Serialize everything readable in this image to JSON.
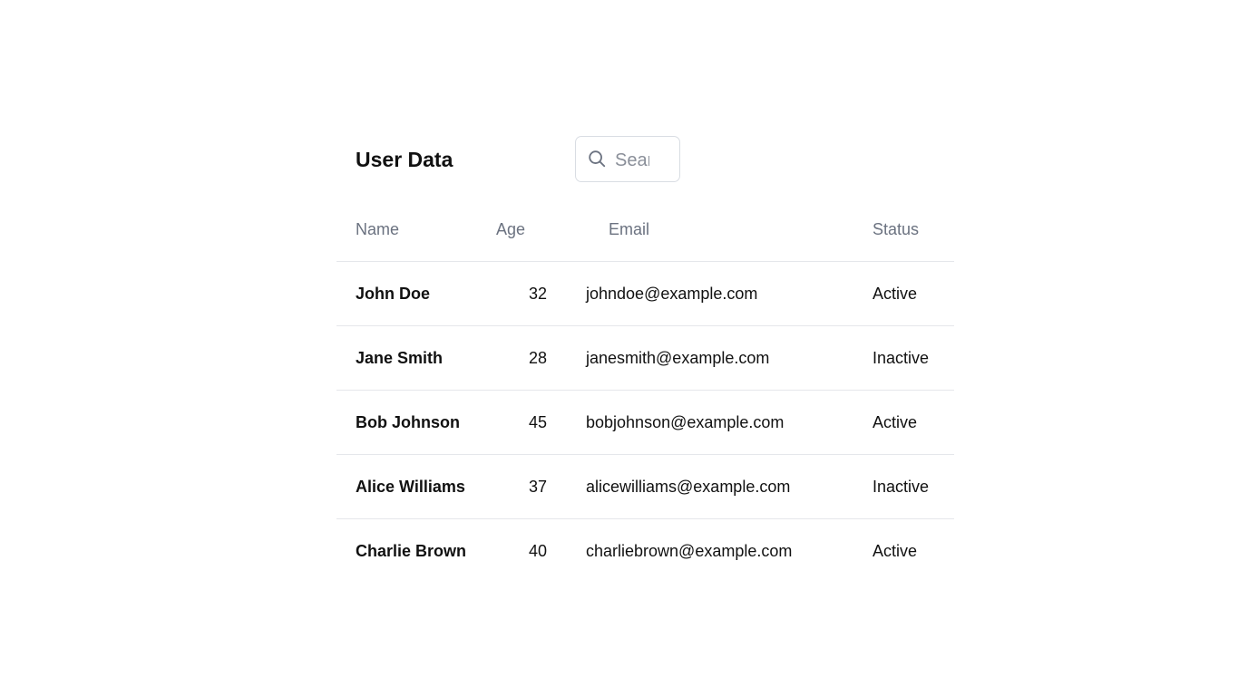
{
  "title": "User Data",
  "search": {
    "placeholder": "Search",
    "value": ""
  },
  "table": {
    "headers": {
      "name": "Name",
      "age": "Age",
      "email": "Email",
      "status": "Status"
    },
    "rows": [
      {
        "name": "John Doe",
        "age": "32",
        "email": "johndoe@example.com",
        "status": "Active"
      },
      {
        "name": "Jane Smith",
        "age": "28",
        "email": "janesmith@example.com",
        "status": "Inactive"
      },
      {
        "name": "Bob Johnson",
        "age": "45",
        "email": "bobjohnson@example.com",
        "status": "Active"
      },
      {
        "name": "Alice Williams",
        "age": "37",
        "email": "alicewilliams@example.com",
        "status": "Inactive"
      },
      {
        "name": "Charlie Brown",
        "age": "40",
        "email": "charliebrown@example.com",
        "status": "Active"
      }
    ]
  }
}
